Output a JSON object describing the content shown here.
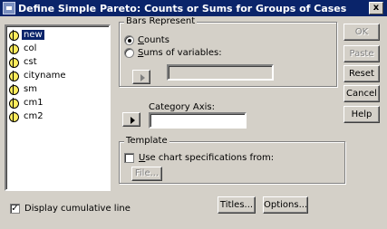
{
  "window": {
    "title": "Define Simple Pareto: Counts or Sums for Groups of Cases",
    "close_glyph": "x"
  },
  "variables": [
    {
      "label": "new",
      "selected": true
    },
    {
      "label": "col",
      "selected": false
    },
    {
      "label": "cst",
      "selected": false
    },
    {
      "label": "cityname",
      "selected": false
    },
    {
      "label": "sm",
      "selected": false
    },
    {
      "label": "cm1",
      "selected": false
    },
    {
      "label": "cm2",
      "selected": false
    }
  ],
  "bars_represent": {
    "legend": "Bars Represent",
    "counts_label": "Counts",
    "sums_label": "Sums of variables:",
    "selected": "counts"
  },
  "category_axis": {
    "label": "Category Axis:"
  },
  "template": {
    "legend": "Template",
    "use_label": "Use chart specifications from:",
    "file_button": "File..."
  },
  "buttons": {
    "ok": "OK",
    "paste": "Paste",
    "reset": "Reset",
    "cancel": "Cancel",
    "help": "Help",
    "titles": "Titles...",
    "options": "Options..."
  },
  "cumulative": {
    "label": "Display cumulative line",
    "checked": true,
    "check_glyph": "✓"
  }
}
